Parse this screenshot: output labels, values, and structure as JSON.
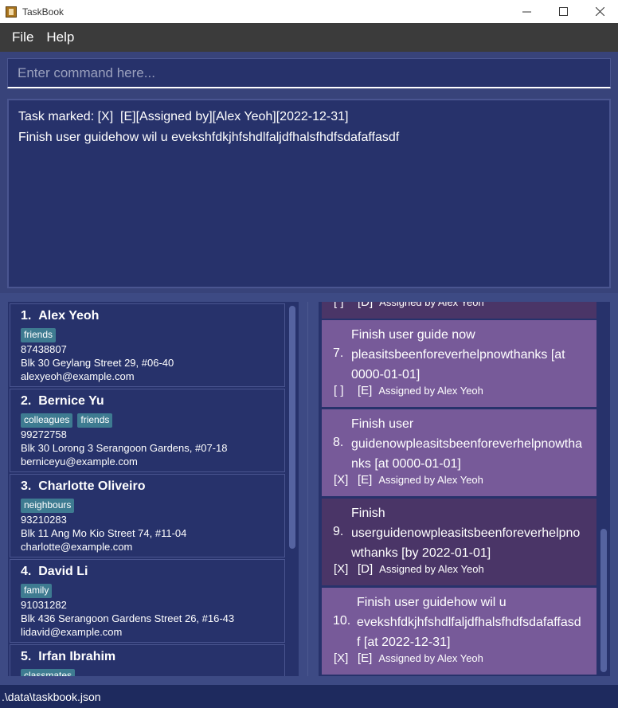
{
  "window": {
    "title": "TaskBook"
  },
  "menu": {
    "file": "File",
    "help": "Help"
  },
  "command": {
    "placeholder": "Enter command here..."
  },
  "result": {
    "line1": "Task marked: [X]  [E][Assigned by][Alex Yeoh][2022-12-31]",
    "line2": "Finish user guidehow wil u evekshfdkjhfshdlfaljdfhalsfhdfsdafaffasdf"
  },
  "persons": [
    {
      "index": "1.",
      "name": "Alex Yeoh",
      "tags": [
        "friends"
      ],
      "phone": "87438807",
      "address": "Blk 30 Geylang Street 29, #06-40",
      "email": "alexyeoh@example.com"
    },
    {
      "index": "2.",
      "name": "Bernice Yu",
      "tags": [
        "colleagues",
        "friends"
      ],
      "phone": "99272758",
      "address": "Blk 30 Lorong 3 Serangoon Gardens, #07-18",
      "email": "berniceyu@example.com"
    },
    {
      "index": "3.",
      "name": "Charlotte Oliveiro",
      "tags": [
        "neighbours"
      ],
      "phone": "93210283",
      "address": "Blk 11 Ang Mo Kio Street 74, #11-04",
      "email": "charlotte@example.com"
    },
    {
      "index": "4.",
      "name": "David Li",
      "tags": [
        "family"
      ],
      "phone": "91031282",
      "address": "Blk 436 Serangoon Gardens Street 26, #16-43",
      "email": "lidavid@example.com"
    },
    {
      "index": "5.",
      "name": "Irfan Ibrahim",
      "tags": [
        "classmates"
      ],
      "phone": "",
      "address": "",
      "email": ""
    }
  ],
  "tasks_partial": {
    "status": "[ ]",
    "type": "[D]",
    "assigned": "Assigned by  Alex Yeoh"
  },
  "tasks": [
    {
      "index": "7.",
      "desc_lines": [
        "Finish user guide now",
        "pleasitsbeenforeverhelpnowthanks [at",
        "0000-01-01]"
      ],
      "status": "[ ]",
      "type": "[E]",
      "assigned": "Assigned by  Alex Yeoh",
      "shade": "light"
    },
    {
      "index": "8.",
      "desc_lines": [
        "Finish user",
        "guidenowpleasitsbeenforeverhelpnowtha",
        "nks [at 0000-01-01]"
      ],
      "status": "[X]",
      "type": "[E]",
      "assigned": "Assigned by  Alex Yeoh",
      "shade": "light"
    },
    {
      "index": "9.",
      "desc_lines": [
        "Finish",
        "userguidenowpleasitsbeenforeverhelpno",
        "wthanks [by 2022-01-01]"
      ],
      "status": "[X]",
      "type": "[D]",
      "assigned": "Assigned by  Alex Yeoh",
      "shade": "dark"
    },
    {
      "index": "10.",
      "desc_lines": [
        "Finish user guidehow wil u",
        "evekshfdkjhfshdlfaljdfhalsfhdfsdafaffasd",
        "f [at 2022-12-31]"
      ],
      "status": "[X]",
      "type": "[E]",
      "assigned": "Assigned by  Alex Yeoh",
      "shade": "light"
    }
  ],
  "status_bar": {
    "path": ".\\data\\taskbook.json"
  },
  "colors": {
    "background": "#38437a",
    "panel": "#27326b",
    "task_light": "#775a99",
    "task_dark": "#4a3567",
    "tag": "#3e7b91"
  }
}
